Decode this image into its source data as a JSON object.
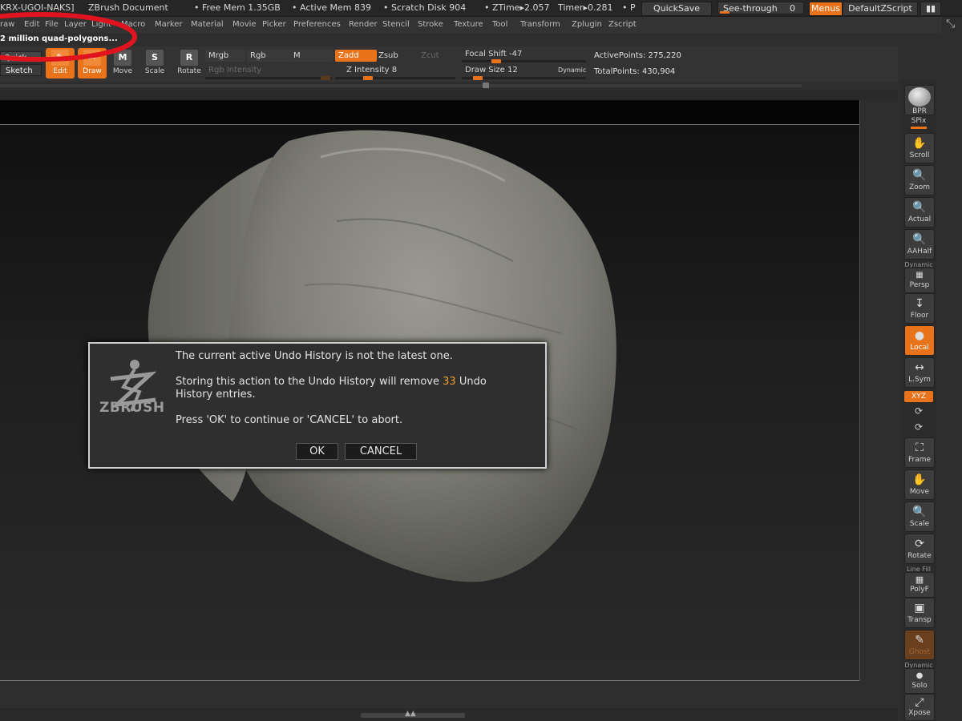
{
  "titlebar": {
    "doc_id": "KRX-UGOI-NAKS]",
    "doc_title": "ZBrush Document",
    "free_mem": "• Free Mem 1.35GB",
    "active_mem": "• Active Mem 839",
    "scratch_disk": "• Scratch Disk 904",
    "ztime": "• ZTime▸2.057",
    "timer": "Timer▸0.281",
    "trail": "• P",
    "quicksave": "QuickSave",
    "see_through_label": "See-through",
    "see_through_value": "0",
    "menus": "Menus",
    "default_zscript": "DefaultZScript"
  },
  "menubar": {
    "items": [
      "raw",
      "Edit",
      "File",
      "Layer",
      "Light",
      "Macro",
      "Marker",
      "Material",
      "Movie",
      "Picker",
      "Preferences",
      "Render",
      "Stencil",
      "Stroke",
      "Texture",
      "Tool",
      "Transform",
      "Zplugin",
      "Zscript"
    ]
  },
  "info": {
    "polycount": "2 million quad-polygons..."
  },
  "toolbar": {
    "quick": "Quick",
    "sketch": "Sketch",
    "edit": "Edit",
    "draw": "Draw",
    "move": "Move",
    "scale": "Scale",
    "rotate": "Rotate",
    "move_icon_letter": "M",
    "scale_icon_letter": "S",
    "rotate_icon_letter": "R",
    "mrgb": "Mrgb",
    "rgb": "Rgb",
    "m": "M",
    "rgb_intensity": "Rgb Intensity",
    "zadd": "Zadd",
    "zsub": "Zsub",
    "zcut": "Zcut",
    "z_intensity": "Z Intensity 8",
    "focal_shift": "Focal Shift -47",
    "draw_size": "Draw Size 12",
    "dynamic": "Dynamic",
    "active_points": "ActivePoints: 275,220",
    "total_points": "TotalPoints: 430,904",
    "z_intensity_level": 0.25,
    "focal_shift_level": 0.26,
    "draw_size_level": 0.1
  },
  "rightshelf": {
    "bpr": "BPR",
    "spix": "SPix",
    "scroll": "Scroll",
    "zoom": "Zoom",
    "actual": "Actual",
    "aahalf": "AAHalf",
    "dynamic1": "Dynamic",
    "persp": "Persp",
    "floor": "Floor",
    "local": "Local",
    "lsym": "L.Sym",
    "xyz": "XYZ",
    "frame": "Frame",
    "move": "Move",
    "scale": "Scale",
    "rotate": "Rotate",
    "line_fill": "Line Fill",
    "polyf": "PolyF",
    "transp": "Transp",
    "ghost": "Ghost",
    "dynamic2": "Dynamic",
    "solo": "Solo",
    "xpose": "Xpose"
  },
  "dialog": {
    "line1": "The current active Undo History is not the latest one.",
    "line2_pre": "Storing this action to the Undo History will remove",
    "line2_count": "33",
    "line2_post": "Undo",
    "line3": "History entries.",
    "line4": "Press 'OK' to continue or 'CANCEL' to abort.",
    "ok": "OK",
    "cancel": "CANCEL",
    "logo_text": "ZBRUSH"
  },
  "colors": {
    "accent": "#e8731a",
    "annotation_red": "#e0141e",
    "highlight_number": "#f0a030"
  }
}
